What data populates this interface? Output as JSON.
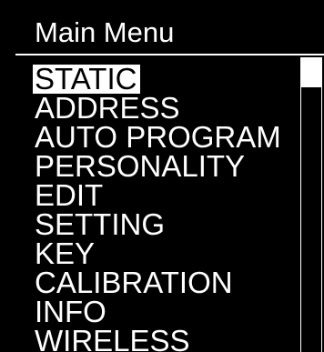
{
  "header": {
    "title": "Main Menu"
  },
  "menu": {
    "items": [
      {
        "label": "STATIC",
        "selected": true
      },
      {
        "label": "ADDRESS",
        "selected": false
      },
      {
        "label": "AUTO PROGRAM",
        "selected": false
      },
      {
        "label": "PERSONALITY",
        "selected": false
      },
      {
        "label": "EDIT",
        "selected": false
      },
      {
        "label": "SETTING",
        "selected": false
      },
      {
        "label": "KEY",
        "selected": false
      },
      {
        "label": "CALIBRATION",
        "selected": false
      },
      {
        "label": "INFO",
        "selected": false
      },
      {
        "label": "WIRELESS",
        "selected": false
      }
    ]
  },
  "colors": {
    "background": "#000000",
    "foreground": "#ffffff"
  }
}
